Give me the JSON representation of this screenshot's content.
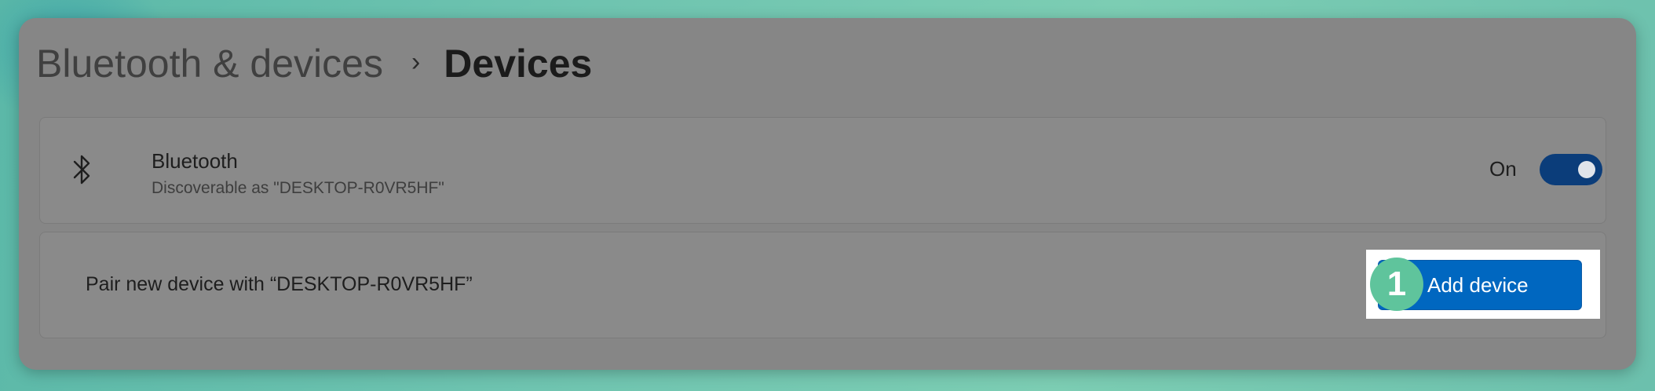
{
  "breadcrumb": {
    "parent": "Bluetooth & devices",
    "separator": "›",
    "current": "Devices"
  },
  "bluetooth_card": {
    "icon": "bluetooth-icon",
    "title": "Bluetooth",
    "subtitle": "Discoverable as \"DESKTOP-R0VR5HF\"",
    "toggle_label": "On",
    "toggle_state": true
  },
  "pair_card": {
    "label": "Pair new device with “DESKTOP-R0VR5HF”",
    "button_label": "Add device"
  },
  "annotation": {
    "step_number": "1"
  },
  "colors": {
    "accent": "#0067c0",
    "toggle_on": "#0b3d7a",
    "step_badge": "#5fc49c",
    "window_overlay": "#868686"
  }
}
